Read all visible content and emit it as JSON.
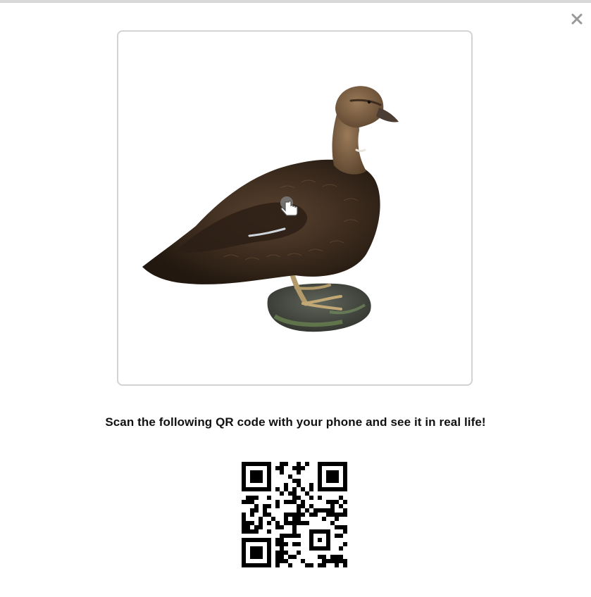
{
  "page": {
    "background_title_fragment": "…"
  },
  "modal": {
    "close_label": "×",
    "instruction_text": "Scan the following QR code with your phone and see it in real life!",
    "viewer": {
      "model_subject": "duck",
      "interaction_hint_icon": "hand-pointer-icon"
    },
    "qr_code": {
      "size_modules": 25
    }
  },
  "colors": {
    "viewer_border": "#d3d3d3",
    "close_icon": "#999999",
    "text": "#111111"
  }
}
